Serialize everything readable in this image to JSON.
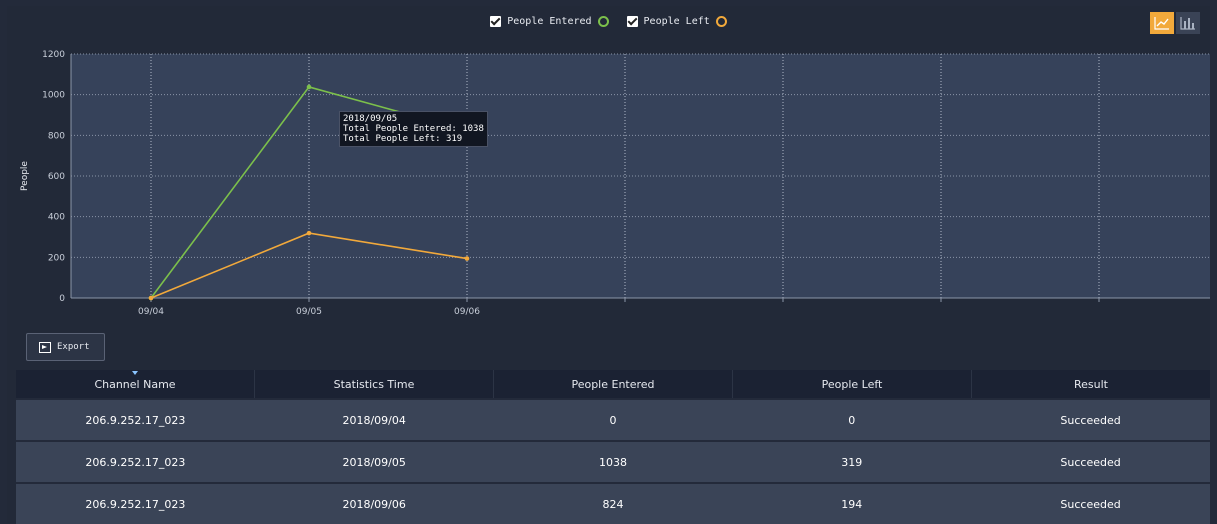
{
  "legend": {
    "entered_label": "People Entered",
    "left_label": "People Left",
    "entered_color": "#7cc04b",
    "left_color": "#f2a93b"
  },
  "view_toggle": {
    "active": "line-chart-icon",
    "inactive": "bar-chart-icon"
  },
  "chart_data": {
    "type": "line",
    "ylabel": "People",
    "xlabel": "",
    "ylim": [
      0,
      1200
    ],
    "yticks": [
      0,
      200,
      400,
      600,
      800,
      1000,
      1200
    ],
    "categories": [
      "09/04",
      "09/05",
      "09/06"
    ],
    "grid": true,
    "series": [
      {
        "name": "People Entered",
        "values": [
          0,
          1038,
          824
        ],
        "color": "#7cc04b"
      },
      {
        "name": "People Left",
        "values": [
          0,
          319,
          194
        ],
        "color": "#f2a93b"
      }
    ]
  },
  "tooltip": {
    "date": "2018/09/05",
    "entered_line": "Total People Entered: 1038",
    "left_line": "Total People Left: 319"
  },
  "export": {
    "label": "Export"
  },
  "table": {
    "headers": [
      "Channel Name",
      "Statistics Time",
      "People Entered",
      "People Left",
      "Result"
    ],
    "rows": [
      [
        "206.9.252.17_023",
        "2018/09/04",
        "0",
        "0",
        "Succeeded"
      ],
      [
        "206.9.252.17_023",
        "2018/09/05",
        "1038",
        "319",
        "Succeeded"
      ],
      [
        "206.9.252.17_023",
        "2018/09/06",
        "824",
        "194",
        "Succeeded"
      ]
    ]
  }
}
